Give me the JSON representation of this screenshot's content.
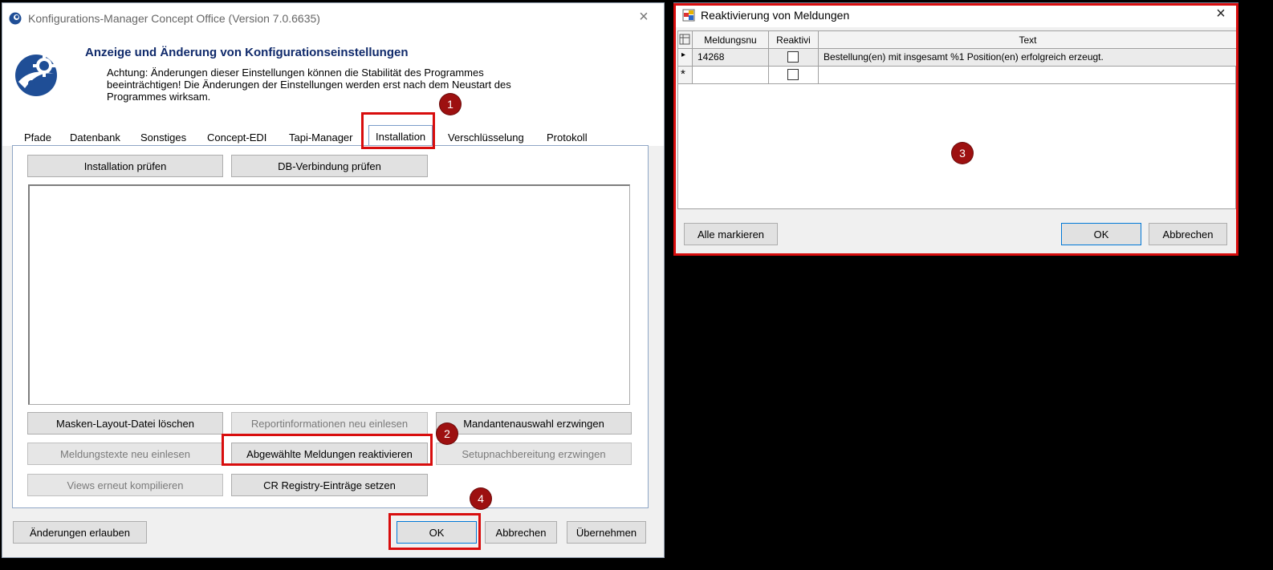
{
  "main_window": {
    "title": "Konfigurations-Manager Concept Office (Version 7.0.6635)",
    "close": "×",
    "header_title": "Anzeige und Änderung von Konfigurationseinstellungen",
    "header_warning": "Achtung: Änderungen dieser Einstellungen können die Stabilität des Programmes beeinträchtigen! Die Änderungen der Einstellungen werden erst nach dem Neustart des Programmes wirksam.",
    "tabs": [
      "Pfade",
      "Datenbank",
      "Sonstiges",
      "Concept-EDI",
      "Tapi-Manager",
      "Installation",
      "Verschlüsselung",
      "Protokoll"
    ],
    "active_tab": "Installation",
    "buttons_top": [
      "Installation prüfen",
      "DB-Verbindung prüfen"
    ],
    "buttons_grid": [
      [
        "Masken-Layout-Datei löschen",
        "Reportinformationen neu einlesen",
        "Mandantenauswahl erzwingen"
      ],
      [
        "Meldungstexte neu einlesen",
        "Abgewählte Meldungen reaktivieren",
        "Setupnachbereitung erzwingen"
      ],
      [
        "Views erneut kompilieren",
        "CR Registry-Einträge setzen"
      ]
    ],
    "footer": {
      "allow_changes": "Änderungen erlauben",
      "ok": "OK",
      "cancel": "Abbrechen",
      "apply": "Übernehmen"
    }
  },
  "dialog": {
    "title": "Reaktivierung von Meldungen",
    "close": "×",
    "columns": [
      "Meldungsnu",
      "Reaktivi",
      "Text"
    ],
    "rows": [
      {
        "nummer": "14268",
        "reaktivieren": false,
        "text": "Bestellung(en) mit insgesamt %1 Position(en) erfolgreich erzeugt."
      }
    ],
    "new_row_marker": "*",
    "current_row_marker": "▸",
    "buttons": {
      "select_all": "Alle markieren",
      "ok": "OK",
      "cancel": "Abbrechen"
    }
  },
  "markers": [
    "1",
    "2",
    "3",
    "4"
  ],
  "colors": {
    "highlight": "#d80d0d",
    "marker": "#9d1010",
    "header_title": "#102a6b"
  }
}
